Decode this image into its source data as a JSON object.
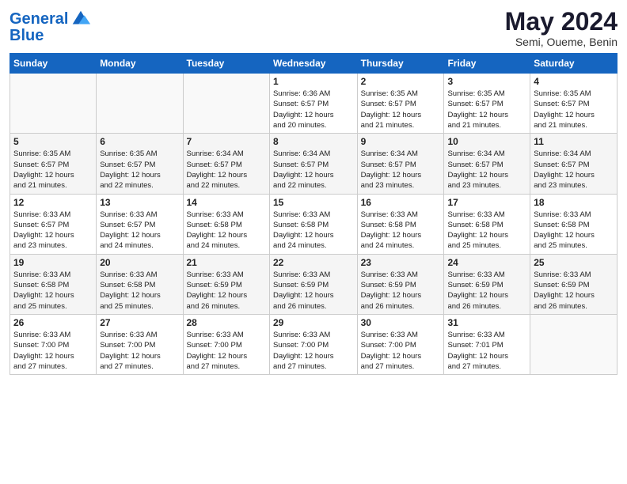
{
  "logo": {
    "line1": "General",
    "line2": "Blue"
  },
  "title": "May 2024",
  "location": "Semi, Oueme, Benin",
  "days_of_week": [
    "Sunday",
    "Monday",
    "Tuesday",
    "Wednesday",
    "Thursday",
    "Friday",
    "Saturday"
  ],
  "weeks": [
    [
      {
        "day": "",
        "info": ""
      },
      {
        "day": "",
        "info": ""
      },
      {
        "day": "",
        "info": ""
      },
      {
        "day": "1",
        "info": "Sunrise: 6:36 AM\nSunset: 6:57 PM\nDaylight: 12 hours\nand 20 minutes."
      },
      {
        "day": "2",
        "info": "Sunrise: 6:35 AM\nSunset: 6:57 PM\nDaylight: 12 hours\nand 21 minutes."
      },
      {
        "day": "3",
        "info": "Sunrise: 6:35 AM\nSunset: 6:57 PM\nDaylight: 12 hours\nand 21 minutes."
      },
      {
        "day": "4",
        "info": "Sunrise: 6:35 AM\nSunset: 6:57 PM\nDaylight: 12 hours\nand 21 minutes."
      }
    ],
    [
      {
        "day": "5",
        "info": "Sunrise: 6:35 AM\nSunset: 6:57 PM\nDaylight: 12 hours\nand 21 minutes."
      },
      {
        "day": "6",
        "info": "Sunrise: 6:35 AM\nSunset: 6:57 PM\nDaylight: 12 hours\nand 22 minutes."
      },
      {
        "day": "7",
        "info": "Sunrise: 6:34 AM\nSunset: 6:57 PM\nDaylight: 12 hours\nand 22 minutes."
      },
      {
        "day": "8",
        "info": "Sunrise: 6:34 AM\nSunset: 6:57 PM\nDaylight: 12 hours\nand 22 minutes."
      },
      {
        "day": "9",
        "info": "Sunrise: 6:34 AM\nSunset: 6:57 PM\nDaylight: 12 hours\nand 23 minutes."
      },
      {
        "day": "10",
        "info": "Sunrise: 6:34 AM\nSunset: 6:57 PM\nDaylight: 12 hours\nand 23 minutes."
      },
      {
        "day": "11",
        "info": "Sunrise: 6:34 AM\nSunset: 6:57 PM\nDaylight: 12 hours\nand 23 minutes."
      }
    ],
    [
      {
        "day": "12",
        "info": "Sunrise: 6:33 AM\nSunset: 6:57 PM\nDaylight: 12 hours\nand 23 minutes."
      },
      {
        "day": "13",
        "info": "Sunrise: 6:33 AM\nSunset: 6:57 PM\nDaylight: 12 hours\nand 24 minutes."
      },
      {
        "day": "14",
        "info": "Sunrise: 6:33 AM\nSunset: 6:58 PM\nDaylight: 12 hours\nand 24 minutes."
      },
      {
        "day": "15",
        "info": "Sunrise: 6:33 AM\nSunset: 6:58 PM\nDaylight: 12 hours\nand 24 minutes."
      },
      {
        "day": "16",
        "info": "Sunrise: 6:33 AM\nSunset: 6:58 PM\nDaylight: 12 hours\nand 24 minutes."
      },
      {
        "day": "17",
        "info": "Sunrise: 6:33 AM\nSunset: 6:58 PM\nDaylight: 12 hours\nand 25 minutes."
      },
      {
        "day": "18",
        "info": "Sunrise: 6:33 AM\nSunset: 6:58 PM\nDaylight: 12 hours\nand 25 minutes."
      }
    ],
    [
      {
        "day": "19",
        "info": "Sunrise: 6:33 AM\nSunset: 6:58 PM\nDaylight: 12 hours\nand 25 minutes."
      },
      {
        "day": "20",
        "info": "Sunrise: 6:33 AM\nSunset: 6:58 PM\nDaylight: 12 hours\nand 25 minutes."
      },
      {
        "day": "21",
        "info": "Sunrise: 6:33 AM\nSunset: 6:59 PM\nDaylight: 12 hours\nand 26 minutes."
      },
      {
        "day": "22",
        "info": "Sunrise: 6:33 AM\nSunset: 6:59 PM\nDaylight: 12 hours\nand 26 minutes."
      },
      {
        "day": "23",
        "info": "Sunrise: 6:33 AM\nSunset: 6:59 PM\nDaylight: 12 hours\nand 26 minutes."
      },
      {
        "day": "24",
        "info": "Sunrise: 6:33 AM\nSunset: 6:59 PM\nDaylight: 12 hours\nand 26 minutes."
      },
      {
        "day": "25",
        "info": "Sunrise: 6:33 AM\nSunset: 6:59 PM\nDaylight: 12 hours\nand 26 minutes."
      }
    ],
    [
      {
        "day": "26",
        "info": "Sunrise: 6:33 AM\nSunset: 7:00 PM\nDaylight: 12 hours\nand 27 minutes."
      },
      {
        "day": "27",
        "info": "Sunrise: 6:33 AM\nSunset: 7:00 PM\nDaylight: 12 hours\nand 27 minutes."
      },
      {
        "day": "28",
        "info": "Sunrise: 6:33 AM\nSunset: 7:00 PM\nDaylight: 12 hours\nand 27 minutes."
      },
      {
        "day": "29",
        "info": "Sunrise: 6:33 AM\nSunset: 7:00 PM\nDaylight: 12 hours\nand 27 minutes."
      },
      {
        "day": "30",
        "info": "Sunrise: 6:33 AM\nSunset: 7:00 PM\nDaylight: 12 hours\nand 27 minutes."
      },
      {
        "day": "31",
        "info": "Sunrise: 6:33 AM\nSunset: 7:01 PM\nDaylight: 12 hours\nand 27 minutes."
      },
      {
        "day": "",
        "info": ""
      }
    ]
  ]
}
